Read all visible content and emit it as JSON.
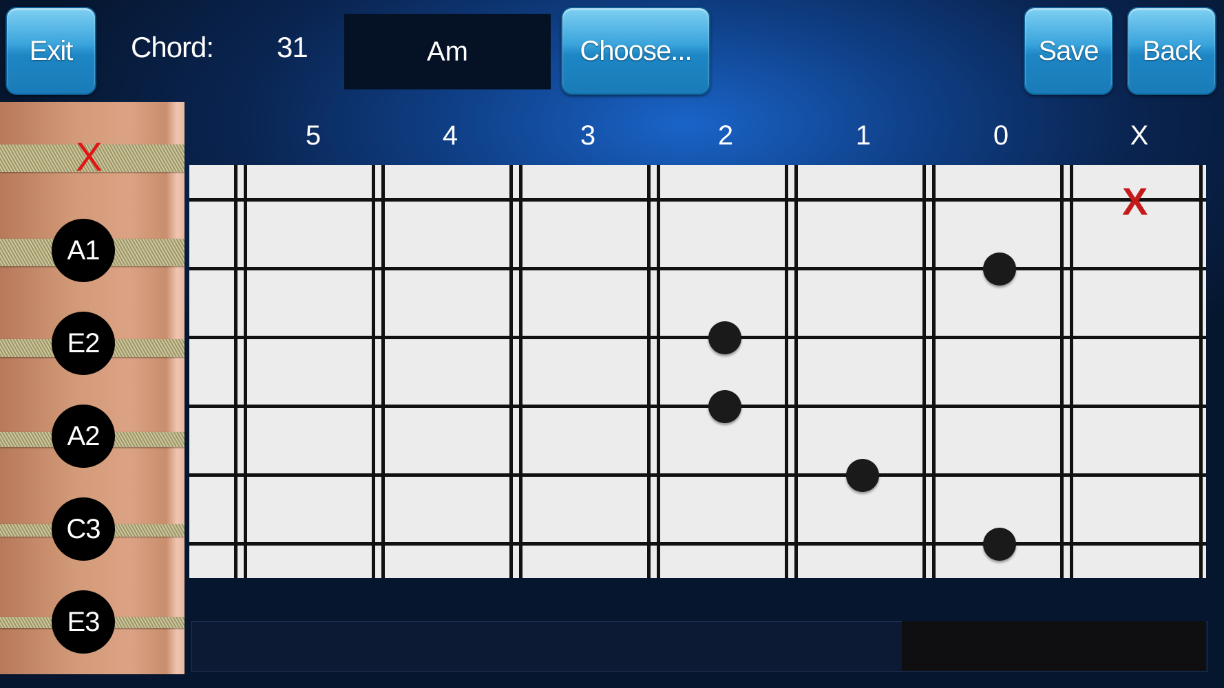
{
  "header": {
    "exit_label": "Exit",
    "chord_label": "Chord:",
    "chord_number": "31",
    "chord_name": "Am",
    "choose_label": "Choose...",
    "save_label": "Save",
    "back_label": "Back"
  },
  "neck": {
    "open_string_mark": "X",
    "notes": [
      "A1",
      "E2",
      "A2",
      "C3",
      "E3"
    ]
  },
  "fret_numbers": [
    "5",
    "4",
    "3",
    "2",
    "1",
    "0",
    "X"
  ],
  "fingering": {
    "muted_mark": "X"
  },
  "colors": {
    "button": "#2a94d0",
    "mute_red": "#c41a1a",
    "board": "#ececec"
  }
}
